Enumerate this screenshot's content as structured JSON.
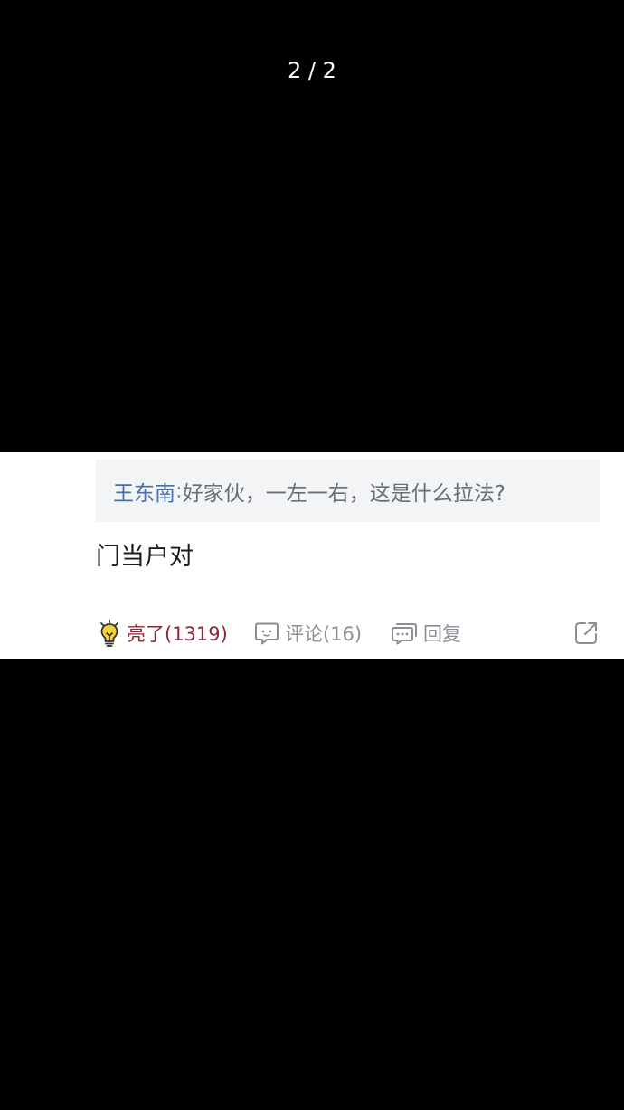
{
  "viewer": {
    "page_indicator": "2 / 2"
  },
  "quote": {
    "author": "王东南",
    "separator": " : ",
    "text": "好家伙，一左一右，这是什么拉法?"
  },
  "reply": {
    "text": "门当户对"
  },
  "actions": {
    "light_label": "亮了(1319)",
    "comment_label": "评论(16)",
    "reply_label": "回复"
  },
  "icons": {
    "light": "lightbulb-icon",
    "comment": "comment-bubble-icon",
    "reply": "reply-bubble-icon",
    "share": "share-icon"
  },
  "colors": {
    "background": "#000000",
    "card": "#ffffff",
    "quote_bg": "#f2f4f6",
    "author": "#4a6eaa",
    "light_active": "#8b2a34",
    "muted": "#8a8f96"
  }
}
